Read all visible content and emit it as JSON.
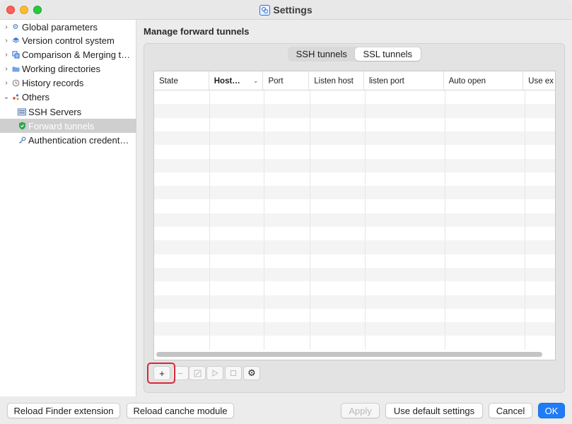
{
  "window": {
    "title": "Settings"
  },
  "sidebar": {
    "items": [
      {
        "label": "Global parameters",
        "icon": "gear-icon",
        "expandable": true,
        "expanded": false,
        "level": 0
      },
      {
        "label": "Version control system",
        "icon": "stack-icon",
        "expandable": true,
        "expanded": false,
        "level": 0
      },
      {
        "label": "Comparison & Merging t…",
        "icon": "compare-icon",
        "expandable": true,
        "expanded": false,
        "level": 0
      },
      {
        "label": "Working directories",
        "icon": "folder-icon",
        "expandable": true,
        "expanded": false,
        "level": 0
      },
      {
        "label": "History records",
        "icon": "history-icon",
        "expandable": true,
        "expanded": false,
        "level": 0
      },
      {
        "label": "Others",
        "icon": "dots-icon",
        "expandable": true,
        "expanded": true,
        "level": 0
      },
      {
        "label": "SSH Servers",
        "icon": "server-icon",
        "expandable": false,
        "level": 1
      },
      {
        "label": "Forward tunnels",
        "icon": "shield-icon",
        "expandable": false,
        "level": 1,
        "selected": true
      },
      {
        "label": "Authentication credent…",
        "icon": "key-icon",
        "expandable": false,
        "level": 1
      }
    ]
  },
  "main": {
    "title": "Manage forward tunnels",
    "tabs": [
      {
        "label": "SSH tunnels",
        "active": false
      },
      {
        "label": "SSL tunnels",
        "active": true
      }
    ],
    "table": {
      "columns": [
        "State",
        "Host…",
        "Port",
        "Listen host",
        "listen port",
        "Auto open",
        "Use ex"
      ],
      "sorted_column": "Host…",
      "rows": []
    },
    "toolbar": {
      "add": "+",
      "remove": "−",
      "edit_icon": "edit-icon",
      "start_icon": "play-icon",
      "stop_icon": "stop-icon",
      "settings_icon": "gear-icon"
    }
  },
  "footer": {
    "reload_finder": "Reload Finder extension",
    "reload_cache": "Reload canche module",
    "apply": "Apply",
    "default_settings": "Use default settings",
    "cancel": "Cancel",
    "ok": "OK"
  },
  "colors": {
    "accent": "#1f7cf6",
    "highlight": "#d62839",
    "selection": "#cfcfcf"
  }
}
